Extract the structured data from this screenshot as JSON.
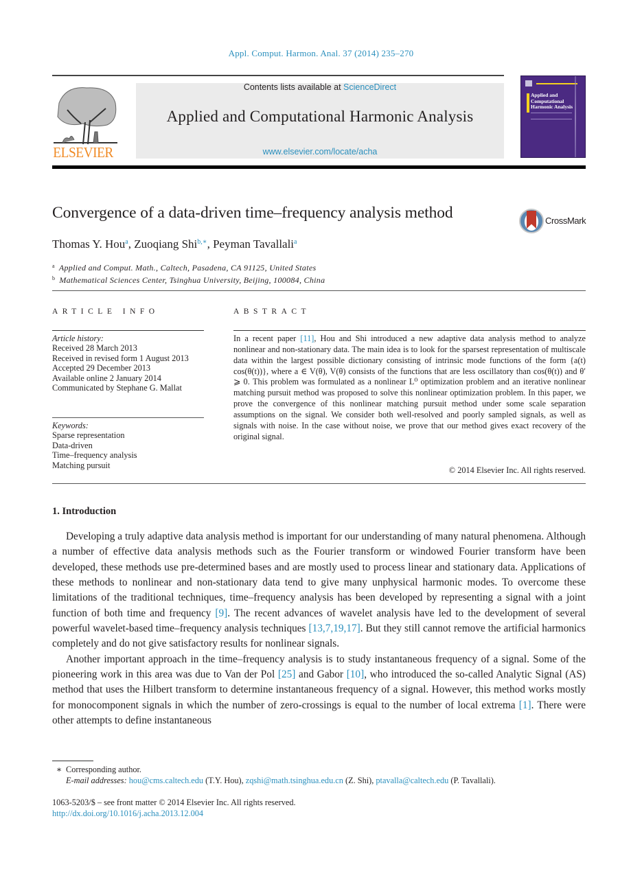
{
  "journal_ref": "Appl. Comput. Harmon. Anal. 37 (2014) 235–270",
  "header": {
    "publisher_logo_text": "ELSEVIER",
    "contents_prefix": "Contents lists available at ",
    "contents_link": "ScienceDirect",
    "journal_name": "Applied and Computational Harmonic Analysis",
    "journal_url": "www.elsevier.com/locate/acha",
    "cover_title": "Applied and Computational Harmonic Analysis",
    "colors": {
      "link": "#2a8fbd",
      "elsevier_orange": "#f08a24",
      "cover_purple": "#4b2a82"
    }
  },
  "article": {
    "title": "Convergence of a data-driven time–frequency analysis method",
    "crossmark_label": "CrossMark",
    "authors": [
      {
        "name": "Thomas Y. Hou",
        "sup": "a"
      },
      {
        "name": "Zuoqiang Shi",
        "sup": "b,∗"
      },
      {
        "name": "Peyman Tavallali",
        "sup": "a"
      }
    ],
    "affiliations": [
      {
        "key": "a",
        "text": "Applied and Comput. Math., Caltech, Pasadena, CA 91125, United States"
      },
      {
        "key": "b",
        "text": "Mathematical Sciences Center, Tsinghua University, Beijing, 100084, China"
      }
    ]
  },
  "article_info": {
    "heading": "ARTICLE INFO",
    "history_label": "Article history:",
    "history": [
      "Received 28 March 2013",
      "Received in revised form 1 August 2013",
      "Accepted 29 December 2013",
      "Available online 2 January 2014",
      "Communicated by Stephane G. Mallat"
    ],
    "keywords_label": "Keywords:",
    "keywords": [
      "Sparse representation",
      "Data-driven",
      "Time–frequency analysis",
      "Matching pursuit"
    ]
  },
  "abstract": {
    "heading": "ABSTRACT",
    "text_1": "In a recent paper ",
    "ref_1": "[11]",
    "text_2": ", Hou and Shi introduced a new adaptive data analysis method to analyze nonlinear and non-stationary data. The main idea is to look for the sparsest representation of multiscale data within the largest possible dictionary consisting of intrinsic mode functions of the form {a(t) cos(θ(t))}, where a ∈ V(θ), V(θ) consists of the functions that are less oscillatory than cos(θ(t)) and θ′ ⩾ 0. This problem was formulated as a nonlinear L⁰ optimization problem and an iterative nonlinear matching pursuit method was proposed to solve this nonlinear optimization problem. In this paper, we prove the convergence of this nonlinear matching pursuit method under some scale separation assumptions on the signal. We consider both well-resolved and poorly sampled signals, as well as signals with noise. In the case without noise, we prove that our method gives exact recovery of the original signal.",
    "copyright": "© 2014 Elsevier Inc. All rights reserved."
  },
  "section": {
    "heading": "1.  Introduction",
    "p1": {
      "a": "Developing a truly adaptive data analysis method is important for our understanding of many natural phenomena. Although a number of effective data analysis methods such as the Fourier transform or windowed Fourier transform have been developed, these methods use pre-determined bases and are mostly used to process linear and stationary data. Applications of these methods to nonlinear and non-stationary data tend to give many unphysical harmonic modes. To overcome these limitations of the traditional techniques, time–frequency analysis has been developed by representing a signal with a joint function of both time and frequency ",
      "ref_a": "[9]",
      "b": ". The recent advances of wavelet analysis have led to the development of several powerful wavelet-based time–frequency analysis techniques ",
      "ref_b": "[13,7,19,17]",
      "c": ". But they still cannot remove the artificial harmonics completely and do not give satisfactory results for nonlinear signals."
    },
    "p2": {
      "a": "Another important approach in the time–frequency analysis is to study instantaneous frequency of a signal. Some of the pioneering work in this area was due to Van der Pol ",
      "ref_a": "[25]",
      "b": " and Gabor ",
      "ref_b": "[10]",
      "c": ", who introduced the so-called Analytic Signal (AS) method that uses the Hilbert transform to determine instantaneous frequency of a signal. However, this method works mostly for monocomponent signals in which the number of zero-crossings is equal to the number of local extrema ",
      "ref_c": "[1]",
      "d": ". There were other attempts to define instantaneous"
    }
  },
  "footnotes": {
    "star": "∗",
    "corresponding": "Corresponding author.",
    "email_label": "E-mail addresses:",
    "emails": [
      {
        "address": "hou@cms.caltech.edu",
        "who": " (T.Y. Hou), "
      },
      {
        "address": "zqshi@math.tsinghua.edu.cn",
        "who": " (Z. Shi), "
      },
      {
        "address": "ptavalla@caltech.edu",
        "who": " (P. Tavallali)."
      }
    ]
  },
  "front_matter": {
    "line": "1063-5203/$ – see front matter  © 2014 Elsevier Inc. All rights reserved.",
    "doi": "http://dx.doi.org/10.1016/j.acha.2013.12.004"
  }
}
